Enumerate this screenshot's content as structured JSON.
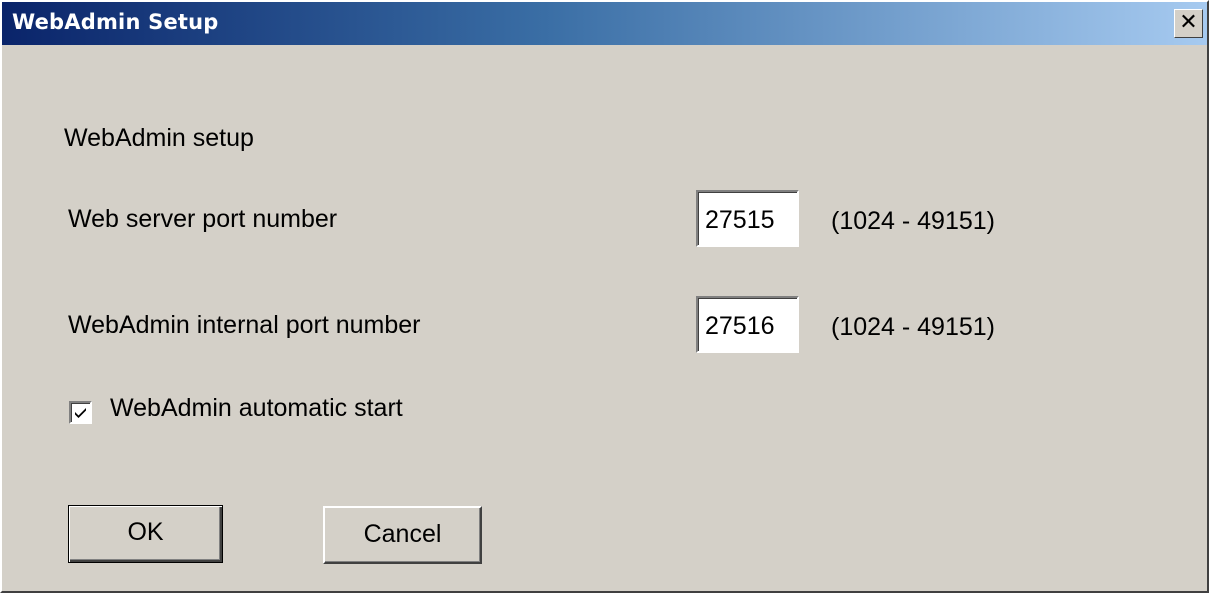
{
  "window": {
    "title": "WebAdmin Setup",
    "close_label": "✕",
    "title_gradient": [
      "#0a246a",
      "#a6caf0"
    ],
    "background_color": "#d4d0c8"
  },
  "form": {
    "heading": "WebAdmin setup",
    "web_server_port": {
      "label": "Web server port number",
      "value": "27515",
      "range": "(1024 - 49151)"
    },
    "internal_port": {
      "label": "WebAdmin internal port number",
      "value": "27516",
      "range": "(1024 - 49151)"
    },
    "auto_start": {
      "label": "WebAdmin automatic start",
      "checked": true
    }
  },
  "buttons": {
    "ok_label": "OK",
    "cancel_label": "Cancel"
  }
}
